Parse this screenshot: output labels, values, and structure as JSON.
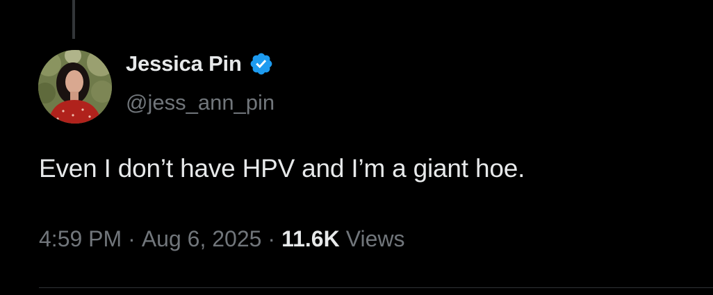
{
  "tweet": {
    "author": {
      "display_name": "Jessica Pin",
      "handle": "@jess_ann_pin",
      "verified": true,
      "avatar_icon": "profile-photo"
    },
    "text": "Even I don’t have HPV and I’m a giant hoe.",
    "meta": {
      "time": "4:59 PM",
      "separator": "·",
      "date": "Aug 6, 2025",
      "views_count": "11.6K",
      "views_label": "Views"
    }
  },
  "colors": {
    "background": "#000000",
    "primary_text": "#e7e9ea",
    "secondary_text": "#71767b",
    "verified_blue": "#1d9bf0",
    "divider": "#2f3336"
  }
}
